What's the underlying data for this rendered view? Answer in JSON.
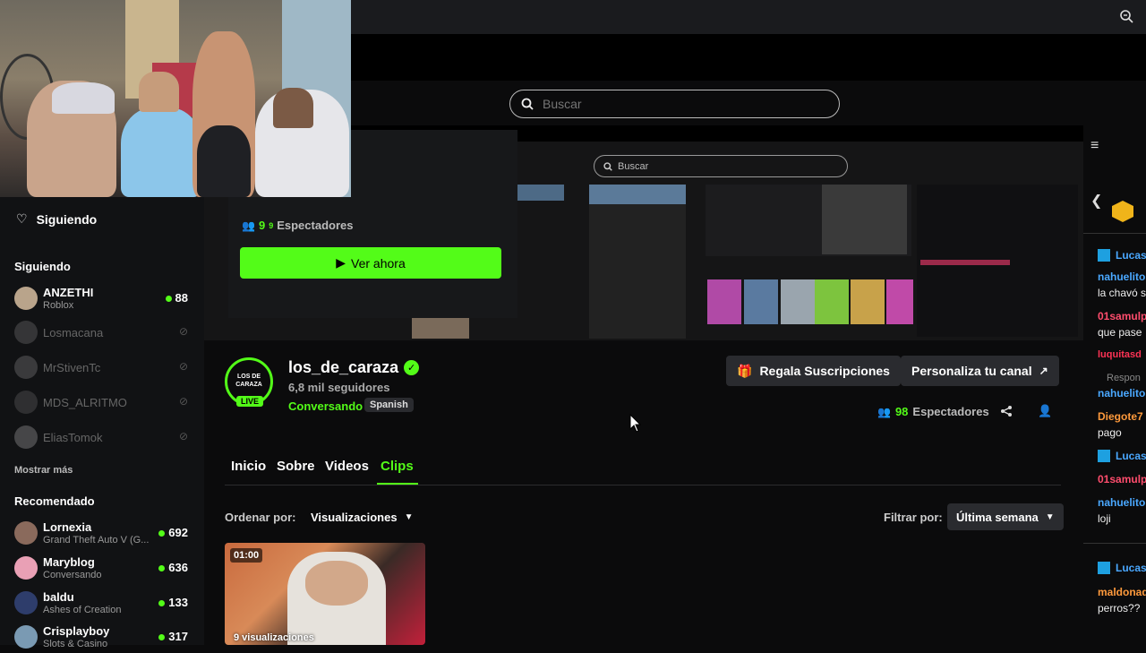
{
  "search": {
    "placeholder": "Buscar",
    "banner_placeholder": "Buscar"
  },
  "sidebar": {
    "following_header": "Siguiendo",
    "following_section": "Siguiendo",
    "following": [
      {
        "name": "ANZETHI",
        "sub": "Roblox",
        "count": "88",
        "live": true,
        "color": "#b9a48b"
      },
      {
        "name": "Losmacana",
        "live": false,
        "color": "#777"
      },
      {
        "name": "MrStivenTc",
        "live": false,
        "color": "#888"
      },
      {
        "name": "MDS_ALRITMO",
        "live": false,
        "color": "#666"
      },
      {
        "name": "EliasTomok",
        "live": false,
        "color": "#aaa"
      }
    ],
    "show_more": "Mostrar más",
    "recommended_section": "Recomendado",
    "recommended": [
      {
        "name": "Lornexia",
        "sub": "Grand Theft Auto V (G...",
        "count": "692",
        "color": "#8a6a5c"
      },
      {
        "name": "Maryblog",
        "sub": "Conversando",
        "count": "636",
        "color": "#e9a0b5"
      },
      {
        "name": "baldu",
        "sub": "Ashes of Creation",
        "count": "133",
        "color": "#2e3d6b"
      },
      {
        "name": "Crisplayboy",
        "sub": "Slots & Casino",
        "count": "317",
        "color": "#7a9ab3"
      }
    ]
  },
  "popup": {
    "viewers_a": "9",
    "viewers_b": "9",
    "viewers_label": "Espectadores",
    "watch_label": "Ver ahora"
  },
  "channel": {
    "name": "los_de_caraza",
    "followers": "6,8 mil seguidores",
    "category": "Conversando",
    "language": "Spanish",
    "live_badge": "LIVE",
    "avatar_text": "LOS DE CARAZA",
    "gift_label": "Regala Suscripciones",
    "customize_label": "Personaliza tu canal",
    "viewers": "98",
    "viewers_label": "Espectadores"
  },
  "tabs": [
    {
      "label": "Inicio",
      "active": false
    },
    {
      "label": "Sobre",
      "active": false
    },
    {
      "label": "Videos",
      "active": false
    },
    {
      "label": "Clips",
      "active": true
    }
  ],
  "filters": {
    "order_label": "Ordenar por:",
    "order_value": "Visualizaciones",
    "filter_label": "Filtrar por:",
    "filter_value": "Última semana"
  },
  "clip": {
    "duration": "01:00",
    "views": "9 visualizaciones"
  },
  "chat": [
    {
      "user": "Lucas",
      "color": "#4aa8ff",
      "text": ""
    },
    {
      "user": "nahuelito",
      "color": "#4aa8ff",
      "text": "la chavó s"
    },
    {
      "user": "01samulp",
      "color": "#ff4d6d",
      "text": "que pase"
    },
    {
      "user": "luquitasd",
      "color": "#ff3355",
      "text": ""
    },
    {
      "user": "Respon",
      "color": "#888",
      "text": ""
    },
    {
      "user": "nahuelito",
      "color": "#4aa8ff",
      "text": ""
    },
    {
      "user": "Diegote7",
      "color": "#ff9a3c",
      "text": "pago"
    },
    {
      "user": "Lucas",
      "color": "#4aa8ff",
      "text": ""
    },
    {
      "user": "01samulp",
      "color": "#ff4d6d",
      "text": ""
    },
    {
      "user": "nahuelito",
      "color": "#4aa8ff",
      "text": "loji"
    },
    {
      "user": "Lucas",
      "color": "#4aa8ff",
      "text": ""
    },
    {
      "user": "maldonad",
      "color": "#ff9a3c",
      "text": "perros??"
    }
  ],
  "colors": {
    "accent": "#53fc18",
    "bg": "#0b0b0c",
    "panel": "#2a2b2f"
  }
}
